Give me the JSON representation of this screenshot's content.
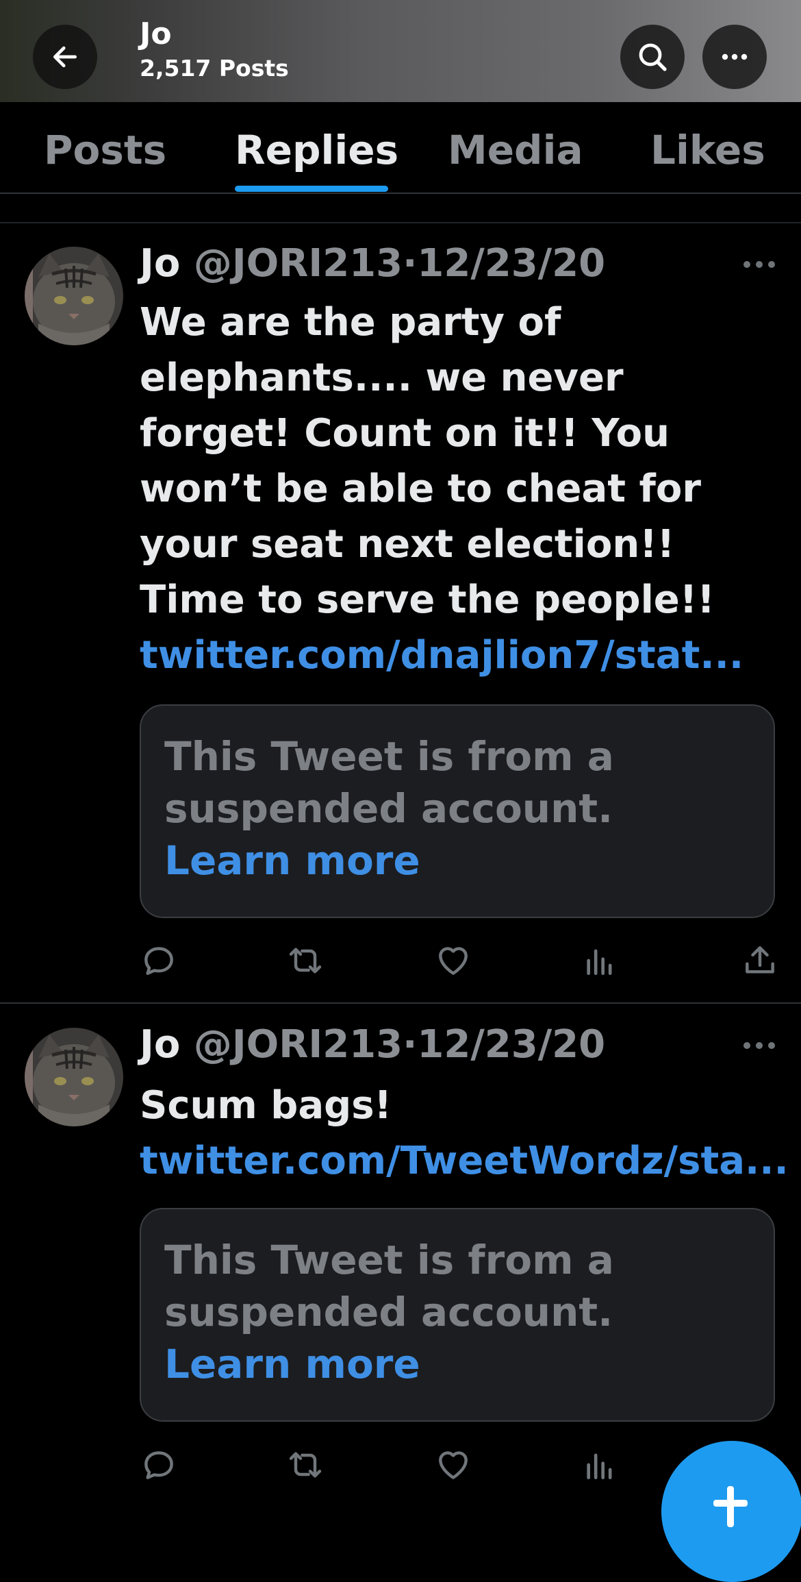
{
  "header": {
    "title": "Jo",
    "post_count": "2,517 Posts"
  },
  "tabs": [
    {
      "label": "Posts",
      "active": false
    },
    {
      "label": "Replies",
      "active": true
    },
    {
      "label": "Media",
      "active": false
    },
    {
      "label": "Likes",
      "active": false
    }
  ],
  "tweets": [
    {
      "name": "Jo",
      "handle": "@JORI213",
      "separator": "·",
      "date": "12/23/20",
      "text": "We are the party of elephants.... we never forget! Count on it!! You won’t be able to cheat for your seat next election!! Time to serve the people!! ",
      "link": "twitter.com/dnajlion7/stat...",
      "quoted_card": {
        "text": "This Tweet is from a suspended account. ",
        "learn_more": "Learn more"
      }
    },
    {
      "name": "Jo",
      "handle": "@JORI213",
      "separator": "·",
      "date": "12/23/20",
      "text": "Scum bags! ",
      "link": "twitter.com/TweetWordz/sta...",
      "quoted_card": {
        "text": "This Tweet is from a suspended account. ",
        "learn_more": "Learn more"
      }
    }
  ],
  "icons": {
    "back": "arrow-left-icon",
    "search": "search-icon",
    "more": "more-horizontal-icon",
    "reply": "reply-icon",
    "retweet": "retweet-icon",
    "like": "heart-icon",
    "views": "views-icon",
    "share": "share-icon",
    "compose": "plus-icon"
  },
  "colors": {
    "accent": "#1d9bf0",
    "link": "#3f8fe5",
    "background": "#000000"
  }
}
